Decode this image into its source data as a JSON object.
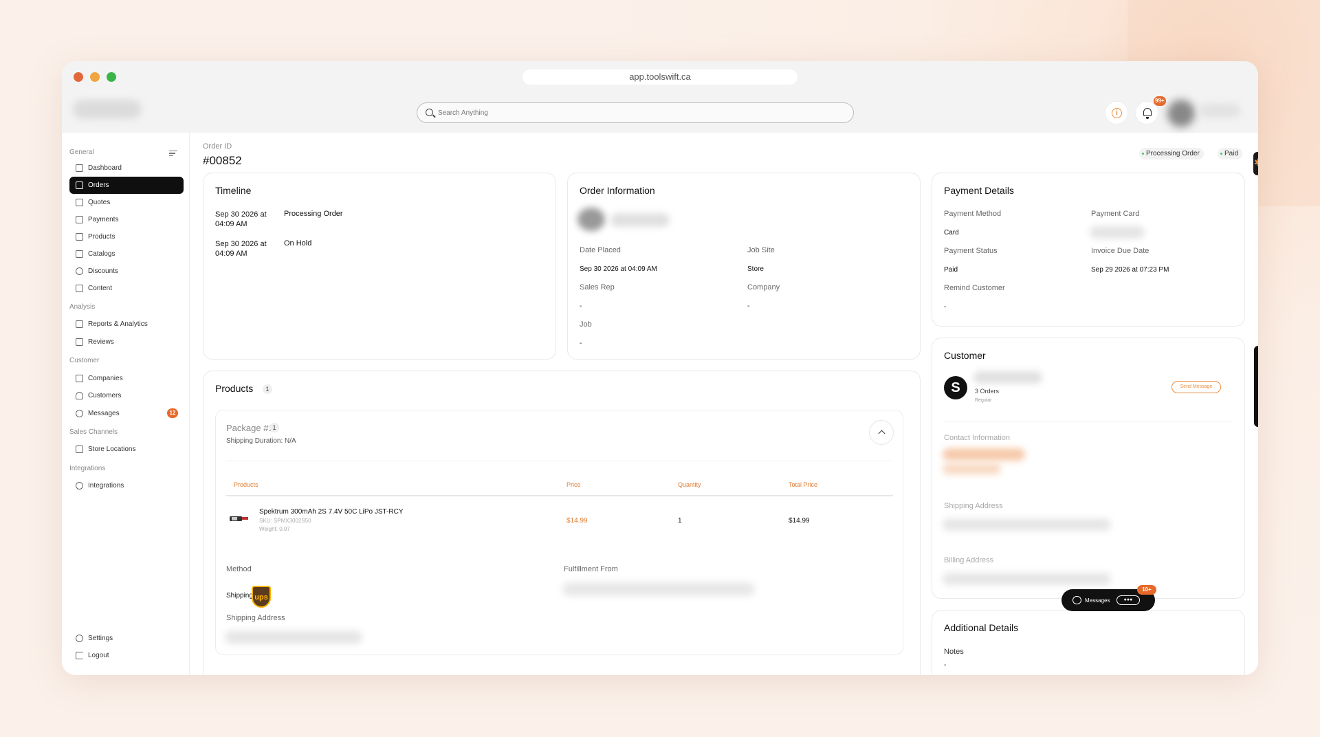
{
  "browser": {
    "url": "app.toolswift.ca"
  },
  "header": {
    "search_placeholder": "Search Anything",
    "notification_count": "99+"
  },
  "sidebar": {
    "sections": {
      "general": "General",
      "analysis": "Analysis",
      "customer": "Customer",
      "sales_channels": "Sales Channels",
      "integrations": "Integrations"
    },
    "items": [
      {
        "label": "Dashboard",
        "icon": "dashboard-icon"
      },
      {
        "label": "Orders",
        "icon": "cart-icon",
        "active": true
      },
      {
        "label": "Quotes",
        "icon": "quote-icon"
      },
      {
        "label": "Payments",
        "icon": "card-icon"
      },
      {
        "label": "Products",
        "icon": "box-icon"
      },
      {
        "label": "Catalogs",
        "icon": "catalog-icon"
      },
      {
        "label": "Discounts",
        "icon": "discount-icon"
      },
      {
        "label": "Content",
        "icon": "pen-icon"
      },
      {
        "label": "Reports & Analytics",
        "icon": "chart-icon"
      },
      {
        "label": "Reviews",
        "icon": "reviews-icon"
      },
      {
        "label": "Companies",
        "icon": "building-icon"
      },
      {
        "label": "Customers",
        "icon": "user-icon"
      },
      {
        "label": "Messages",
        "icon": "chat-icon",
        "badge": "12"
      },
      {
        "label": "Store Locations",
        "icon": "store-icon"
      },
      {
        "label": "Integrations",
        "icon": "plug-icon"
      }
    ],
    "settings": "Settings",
    "logout": "Logout"
  },
  "order": {
    "id_label": "Order ID",
    "id": "#00852",
    "status_processing": "Processing Order",
    "status_paid": "Paid"
  },
  "timeline": {
    "title": "Timeline",
    "events": [
      {
        "date": "Sep 30 2026 at 04:09 AM",
        "status": "Processing Order"
      },
      {
        "date": "Sep 30 2026 at 04:09 AM",
        "status": "On Hold"
      }
    ]
  },
  "order_info": {
    "title": "Order Information",
    "date_placed_label": "Date Placed",
    "date_placed": "Sep 30 2026 at 04:09 AM",
    "job_site_label": "Job Site",
    "job_site": "Store",
    "sales_rep_label": "Sales Rep",
    "sales_rep": "-",
    "company_label": "Company",
    "company": "-",
    "job_label": "Job",
    "job": "-"
  },
  "payment": {
    "title": "Payment Details",
    "method_label": "Payment Method",
    "method": "Card",
    "card_label": "Payment Card",
    "status_label": "Payment Status",
    "status": "Paid",
    "due_label": "Invoice Due Date",
    "due": "Sep 29 2026 at 07:23 PM",
    "remind_label": "Remind Customer",
    "remind": "-"
  },
  "products": {
    "title": "Products",
    "count": "1",
    "package": {
      "title": "Package #1",
      "count": "1",
      "shipping_duration": "Shipping Duration: N/A",
      "columns": [
        "Products",
        "Price",
        "Quantity",
        "Total Price"
      ],
      "rows": [
        {
          "name": "Spektrum 300mAh 2S 7.4V 50C LiPo JST-RCY",
          "sku": "SKU: SPMX3002S50",
          "weight": "Weight: 0.07",
          "price": "$14.99",
          "quantity": "1",
          "total": "$14.99"
        }
      ],
      "method_label": "Method",
      "method": "Shipping",
      "carrier": "ups",
      "fulfillment_label": "Fulfillment From",
      "shipping_address_label": "Shipping Address"
    }
  },
  "customer": {
    "title": "Customer",
    "orders": "3 Orders",
    "tier": "Regular",
    "send_message": "Send Message",
    "contact_label": "Contact Information",
    "shipping_label": "Shipping Address",
    "billing_label": "Billing Address"
  },
  "additional": {
    "title": "Additional Details",
    "notes_label": "Notes",
    "notes": "-"
  },
  "messages_widget": {
    "label": "Messages",
    "badge": "10+"
  },
  "colors": {
    "accent": "#e7692a",
    "active_nav": "#0f0f0f",
    "paid_dot": "#4ac06a"
  }
}
